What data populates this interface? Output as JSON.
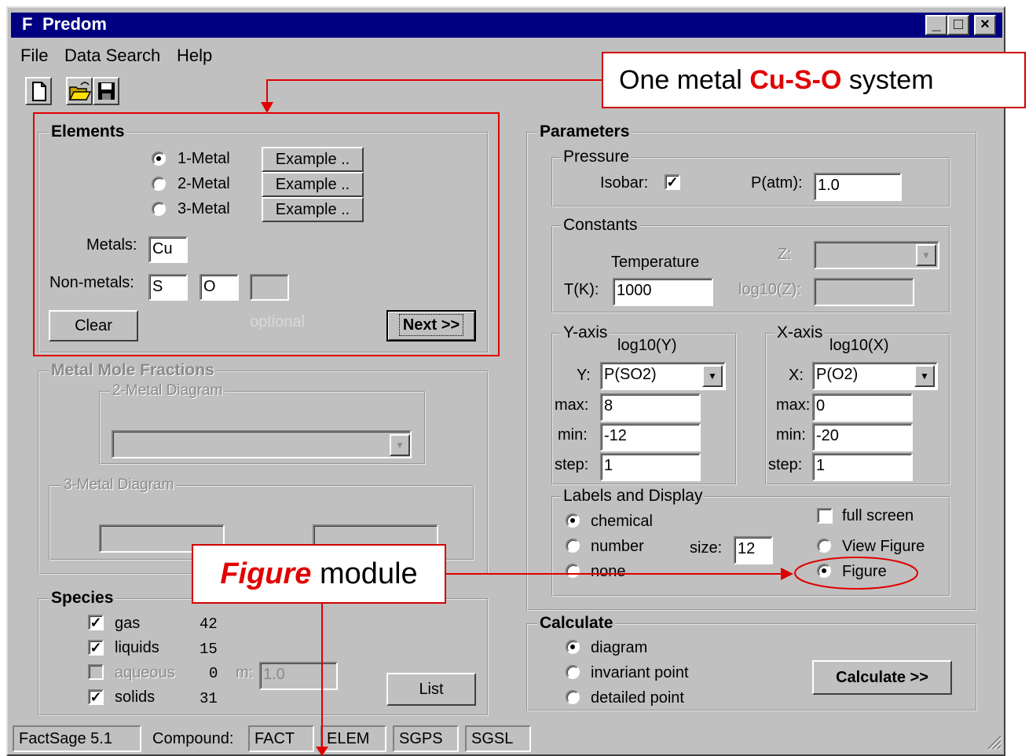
{
  "window": {
    "title": "Predom",
    "app_icon": "F",
    "min": "_",
    "max": "□",
    "close": "×"
  },
  "menu": [
    "File",
    "Data Search",
    "Help"
  ],
  "toolbar": {
    "icons": [
      "new-file-icon",
      "open-folder-icon",
      "save-disk-icon"
    ]
  },
  "elements": {
    "title": "Elements",
    "options": [
      "1-Metal",
      "2-Metal",
      "3-Metal"
    ],
    "selected": "1-Metal",
    "example_label": "Example ..",
    "metals_label": "Metals:",
    "metal_value": "Cu",
    "nonmetals_label": "Non-metals:",
    "nonmetal_values": [
      "S",
      "O",
      ""
    ],
    "clear": "Clear",
    "optional": "optional",
    "next": "Next >>"
  },
  "mole_fractions": {
    "title": "Metal Mole Fractions",
    "two": "2-Metal Diagram",
    "three": "3-Metal Diagram"
  },
  "species": {
    "title": "Species",
    "items": [
      {
        "label": "gas",
        "count": "42",
        "checked": true
      },
      {
        "label": "liquids",
        "count": "15",
        "checked": true
      },
      {
        "label": "aqueous",
        "count": "0",
        "checked": false
      },
      {
        "label": "solids",
        "count": "31",
        "checked": true
      }
    ],
    "m_label": "m:",
    "m_value": "1.0",
    "list": "List"
  },
  "parameters": {
    "title": "Parameters",
    "pressure": {
      "title": "Pressure",
      "isobar": "Isobar:",
      "isobar_checked": true,
      "patm_label": "P(atm):",
      "patm": "1.0"
    },
    "constants": {
      "title": "Constants",
      "temperature": "Temperature",
      "tk_label": "T(K):",
      "tk": "1000",
      "z_label": "Z:",
      "log10z_label": "log10(Z):"
    },
    "yaxis": {
      "title": "Y-axis",
      "sub": "log10(Y)",
      "var_label": "Y:",
      "var": "P(SO2)",
      "max_label": "max:",
      "max": "8",
      "min_label": "min:",
      "min": "-12",
      "step_label": "step:",
      "step": "1"
    },
    "xaxis": {
      "title": "X-axis",
      "sub": "log10(X)",
      "var_label": "X:",
      "var": "P(O2)",
      "max_label": "max:",
      "max": "0",
      "min_label": "min:",
      "min": "-20",
      "step_label": "step:",
      "step": "1"
    },
    "labels": {
      "title": "Labels and Display",
      "options": [
        "chemical",
        "number",
        "none"
      ],
      "selected": "chemical",
      "size_label": "size:",
      "size": "12",
      "fullscreen": "full screen",
      "view_options": [
        "View Figure",
        "Figure"
      ],
      "view_selected": "Figure"
    }
  },
  "calculate": {
    "title": "Calculate",
    "options": [
      "diagram",
      "invariant point",
      "detailed point"
    ],
    "selected": "diagram",
    "button": "Calculate >>"
  },
  "statusbar": {
    "version": "FactSage 5.1",
    "compound_label": "Compound:",
    "dbs": [
      "FACT",
      "ELEM",
      "SGPS",
      "SGSL"
    ]
  },
  "annotations": {
    "callout1_pre": "One metal ",
    "callout1_em": "Cu-S-O",
    "callout1_post": " system",
    "callout2_em": "Figure",
    "callout2_post": " module",
    "color": "#e00000"
  }
}
